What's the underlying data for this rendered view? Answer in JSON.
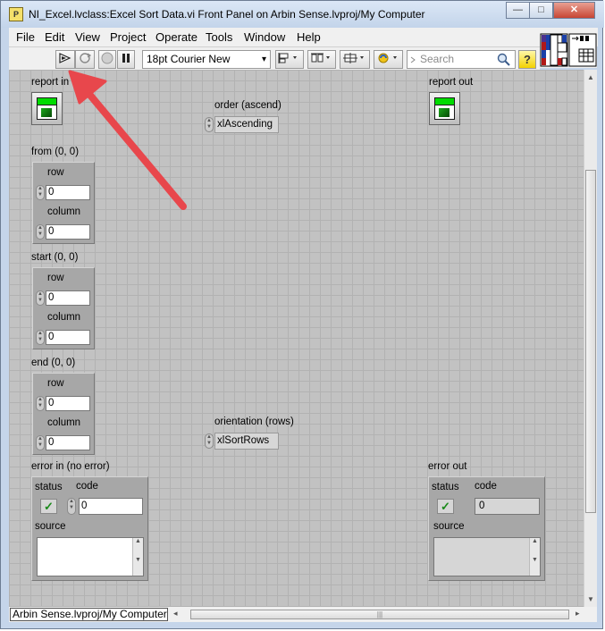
{
  "window": {
    "app_icon": "labview-vi-icon",
    "app_icon_text": "P",
    "title": "NI_Excel.lvclass:Excel Sort Data.vi Front Panel on Arbin Sense.lvproj/My Computer",
    "minimize_glyph": "—",
    "maximize_glyph": "□",
    "close_glyph": "✕"
  },
  "menu": {
    "items": [
      "File",
      "Edit",
      "View",
      "Project",
      "Operate",
      "Tools",
      "Window",
      "Help"
    ]
  },
  "toolbar": {
    "run_icon": "run-arrow-icon",
    "run_continuously_icon": "run-continuously-icon",
    "abort_icon": "abort-icon",
    "pause_icon": "pause-icon",
    "font": "18pt Courier New",
    "align_icon": "align-objects-icon",
    "distribute_icon": "distribute-objects-icon",
    "resize_icon": "resize-objects-icon",
    "reorder_icon": "reorder-icon",
    "search_placeholder": "Search",
    "help_icon": "context-help-icon",
    "dropdown_glyph": "▾"
  },
  "panel": {
    "report_in": {
      "label": "report in"
    },
    "report_out": {
      "label": "report out"
    },
    "order": {
      "label": "order (ascend)",
      "value": "xlAscending"
    },
    "from": {
      "label": "from (0, 0)",
      "row_label": "row",
      "row_value": "0",
      "column_label": "column",
      "column_value": "0"
    },
    "start": {
      "label": "start (0, 0)",
      "row_label": "row",
      "row_value": "0",
      "column_label": "column",
      "column_value": "0"
    },
    "end": {
      "label": "end (0, 0)",
      "row_label": "row",
      "row_value": "0",
      "column_label": "column",
      "column_value": "0"
    },
    "orientation": {
      "label": "orientation (rows)",
      "value": "xlSortRows"
    },
    "error_in": {
      "label": "error in (no error)",
      "status_label": "status",
      "code_label": "code",
      "code_value": "0",
      "source_label": "source",
      "status_mark": "✓"
    },
    "error_out": {
      "label": "error out",
      "status_label": "status",
      "code_label": "code",
      "code_value": "0",
      "source_label": "source",
      "status_mark": "✓"
    }
  },
  "annotation": {
    "arrow_color": "#e8474c"
  },
  "statusbar": {
    "context": "Arbin Sense.lvproj/My Computer"
  }
}
